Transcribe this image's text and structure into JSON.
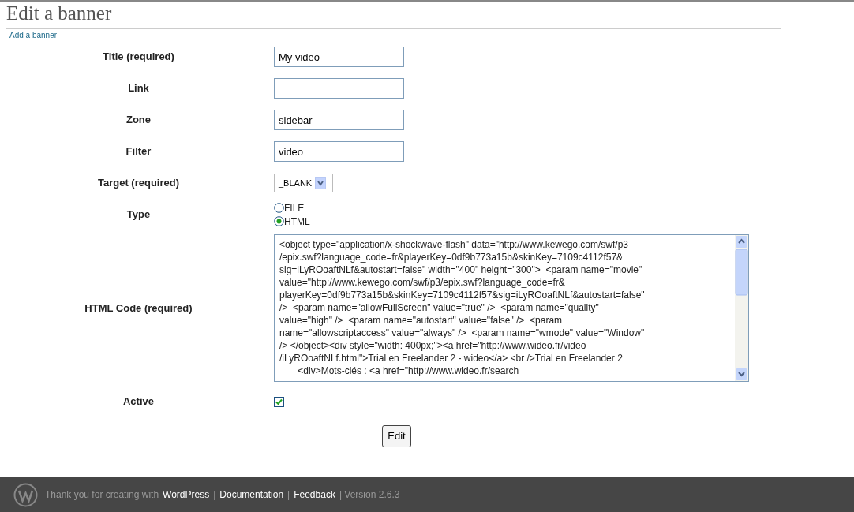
{
  "page_title": "Edit a banner",
  "add_link": "Add a banner",
  "fields": [
    {
      "kind": "text",
      "label": "Title (required)",
      "value": "My video"
    },
    {
      "kind": "text",
      "label": "Link"
    },
    {
      "kind": "text",
      "label": "Zone",
      "value": "sidebar"
    },
    {
      "kind": "text",
      "label": "Filter",
      "value": "video"
    },
    {
      "kind": "select",
      "label": "Target (required)",
      "value": "_BLANK"
    },
    {
      "kind": "radio",
      "label": "Type",
      "options": [
        {
          "label": "FILE",
          "selected": false
        },
        {
          "label": "HTML",
          "selected": true
        }
      ]
    },
    {
      "kind": "code",
      "label": "HTML Code (required)",
      "lines": [
        "<object type=\"application/x-shockwave-flash\" data=\"http://www.kewego.com/swf/p3",
        "/epix.swf?language_code=fr&playerKey=0df9b773a15b&skinKey=7109c4112f57&",
        "sig=iLyROoaftNLf&autostart=false\" width=\"400\" height=\"300\">  <param name=\"movie\"",
        "value=\"http://www.kewego.com/swf/p3/epix.swf?language_code=fr&",
        "playerKey=0df9b773a15b&skinKey=7109c4112f57&sig=iLyROoaftNLf&autostart=false\"",
        "/>  <param name=\"allowFullScreen\" value=\"true\" />  <param name=\"quality\"",
        "value=\"high\" />  <param name=\"autostart\" value=\"false\" />  <param",
        "name=\"allowscriptaccess\" value=\"always\" />  <param name=\"wmode\" value=\"Window\"",
        "/> </object><div style=\"width: 400px;\"><a href=\"http://www.wideo.fr/video",
        "/iLyROoaftNLf.html\">Trial en Freelander 2 - wideo</a> <br />Trial en Freelander 2",
        "       <div>Mots-clés : <a href=\"http://www.wideo.fr/search"
      ]
    },
    {
      "kind": "checkbox",
      "label": "Active",
      "checked": true
    }
  ],
  "submit": "Edit",
  "footer": [
    {
      "kind": "text",
      "text": "Thank you for creating with"
    },
    {
      "kind": "link",
      "text": "WordPress"
    },
    {
      "kind": "text",
      "text": "|"
    },
    {
      "kind": "link",
      "text": "Documentation"
    },
    {
      "kind": "text",
      "text": "|"
    },
    {
      "kind": "link",
      "text": "Feedback"
    },
    {
      "kind": "text",
      "text": "| Version 2.6.3"
    }
  ]
}
